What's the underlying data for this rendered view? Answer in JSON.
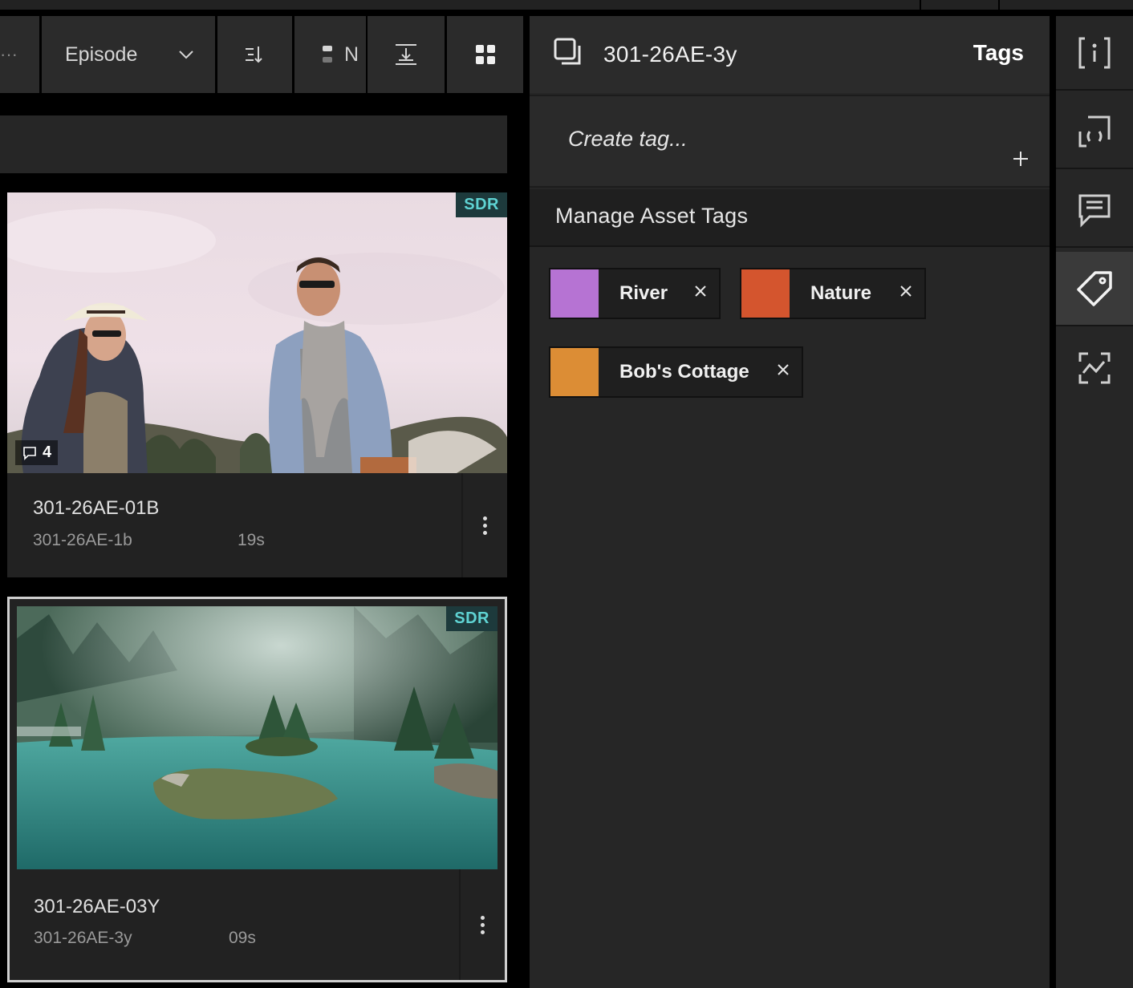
{
  "toolbar": {
    "more_label": "···",
    "group_by_label": "Episode",
    "name_label": "N"
  },
  "assets": [
    {
      "title": "301-26AE-01B",
      "subtitle": "301-26AE-1b",
      "duration": "19s",
      "badge": "SDR",
      "comments": "4",
      "selected": false
    },
    {
      "title": "301-26AE-03Y",
      "subtitle": "301-26AE-3y",
      "duration": "09s",
      "badge": "SDR",
      "selected": true
    }
  ],
  "panel": {
    "asset_name": "301-26AE-3y",
    "tab_title": "Tags",
    "create_placeholder": "Create tag...",
    "manage_label": "Manage Asset Tags",
    "tags": [
      {
        "name": "River",
        "color": "#b673d3"
      },
      {
        "name": "Nature",
        "color": "#d4552e"
      },
      {
        "name": "Bob's Cottage",
        "color": "#dc8d35"
      }
    ]
  },
  "rail": {
    "items": [
      "info-icon",
      "frame-icon",
      "comments-icon",
      "tag-icon",
      "compare-icon"
    ],
    "active": "tag-icon"
  },
  "colors": {
    "sdr_text": "#5fd3d3",
    "sdr_bg": "#1d3a3c",
    "panel_bg": "#262626"
  }
}
